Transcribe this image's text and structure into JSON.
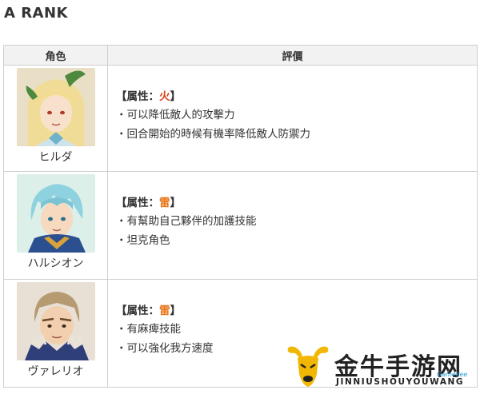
{
  "title": "A RANK",
  "table": {
    "headers": {
      "character": "角色",
      "evaluation": "評價"
    },
    "rows": [
      {
        "name": "ヒルダ",
        "attribute_label": "【属性：",
        "attribute_value": "火",
        "attribute_close": "】",
        "attribute_color": "#d9401a",
        "bullets": [
          "・可以降低敵人的攻擊力",
          "・回合開始的時候有機率降低敵人防禦力"
        ],
        "portrait_icon": "blonde-character-portrait-icon"
      },
      {
        "name": "ハルシオン",
        "attribute_label": "【属性：",
        "attribute_value": "雷",
        "attribute_close": "】",
        "attribute_color": "#e8751a",
        "bullets": [
          "・有幫助自己夥伴的加護技能",
          "・坦克角色"
        ],
        "portrait_icon": "blue-hair-character-portrait-icon"
      },
      {
        "name": "ヴァレリオ",
        "attribute_label": "【属性：",
        "attribute_value": "雷",
        "attribute_close": "】",
        "attribute_color": "#e8751a",
        "bullets": [
          "・有麻痺技能",
          "・可以強化我方速度"
        ],
        "portrait_icon": "brown-hair-character-portrait-icon"
      }
    ]
  },
  "watermark": {
    "text": "金牛手游网",
    "subtext": "JINNIUSHOUYOUWANG",
    "badge": "Gamekee",
    "icon": "bull-head-logo-icon"
  }
}
